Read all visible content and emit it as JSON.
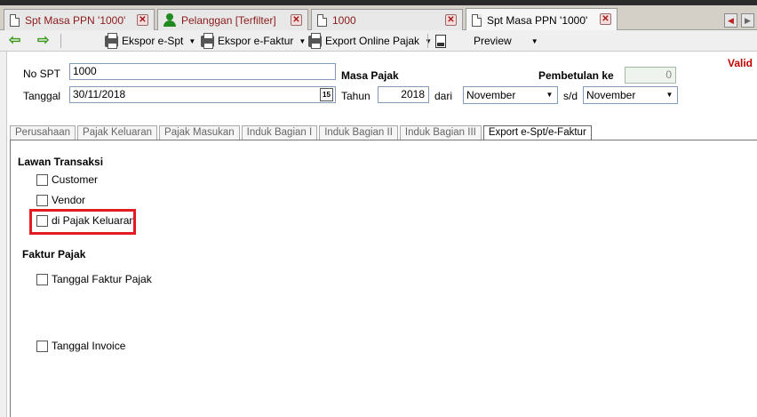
{
  "tabs": [
    {
      "label": "Spt Masa PPN '1000'",
      "icon": "page-icon",
      "red": true
    },
    {
      "label": "Pelanggan [Terfilter]",
      "icon": "person-icon",
      "red": true
    },
    {
      "label": "1000",
      "icon": "page-icon",
      "red": true
    },
    {
      "label": "Spt Masa PPN '1000'",
      "icon": "page-icon",
      "red": false
    }
  ],
  "toolbar": {
    "ekspor_espt": "Ekspor e-Spt",
    "ekspor_efaktur": "Ekspor e-Faktur",
    "export_online": "Export Online Pajak",
    "preview": "Preview"
  },
  "form": {
    "no_spt_label": "No SPT",
    "no_spt_value": "1000",
    "tanggal_label": "Tanggal",
    "tanggal_value": "30/11/2018",
    "masa_pajak_label": "Masa Pajak",
    "tahun_label": "Tahun",
    "tahun_value": "2018",
    "dari_label": "dari",
    "dari_value": "November",
    "sd_label": "s/d",
    "sd_value": "November",
    "pembetulan_label": "Pembetulan ke",
    "pembetulan_value": "0",
    "status": "Valid"
  },
  "inner_tabs": [
    "Perusahaan",
    "Pajak Keluaran",
    "Pajak Masukan",
    "Induk Bagian I",
    "Induk Bagian II",
    "Induk Bagian III",
    "Export e-Spt/e-Faktur"
  ],
  "active_inner_tab": 6,
  "export": {
    "lawan_transaksi_title": "Lawan Transaksi",
    "customer_label": "Customer",
    "vendor_label": "Vendor",
    "di_pajak_keluaran_label": "di Pajak Keluaran",
    "faktur_pajak_title": "Faktur Pajak",
    "tanggal_faktur_label": "Tanggal Faktur Pajak",
    "tanggal_invoice_label": "Tanggal Invoice"
  },
  "colors": {
    "highlight": "#e31b23",
    "valid": "#c00000",
    "arrow": "#3c9a1c"
  }
}
